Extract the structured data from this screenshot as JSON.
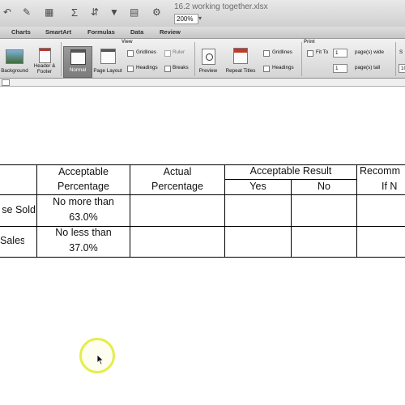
{
  "window": {
    "title": "16.2 working together.xlsx",
    "zoom": "200%"
  },
  "tabs": [
    "Charts",
    "SmartArt",
    "Formulas",
    "Data",
    "Review"
  ],
  "ribbon": {
    "group_view": "View",
    "group_print": "Print",
    "background": "Background",
    "header_footer": "Header &\nFooter",
    "normal": "Normal",
    "page_layout": "Page Layout",
    "gridlines_view": "Gridlines",
    "ruler": "Ruler",
    "headings_view": "Headings",
    "breaks": "Breaks",
    "preview": "Preview",
    "repeat_titles": "Repeat Titles",
    "gridlines_print": "Gridlines",
    "headings_print": "Headings",
    "fit_to": "Fit To",
    "pages_wide_value": "1",
    "pages_wide_label": "page(s) wide",
    "pages_tall_value": "1",
    "pages_tall_label": "page(s) tall",
    "scale_label_partial": "S",
    "scale_value_partial": "10"
  },
  "sheet": {
    "header": {
      "acceptable_percentage_line1": "Acceptable",
      "acceptable_percentage_line2": "Percentage",
      "actual_percentage_line1": "Actual",
      "actual_percentage_line2": "Percentage",
      "acceptable_result": "Acceptable Result",
      "yes": "Yes",
      "no": "No",
      "recommend_line1": "Recomm",
      "recommend_line2": "If N"
    },
    "rows": [
      {
        "label": "se Sold",
        "acceptable_line1": "No more than",
        "acceptable_line2": "63.0%"
      },
      {
        "label": "Sales",
        "acceptable_line1": "No less than",
        "acceptable_line2": "37.0%"
      }
    ]
  }
}
